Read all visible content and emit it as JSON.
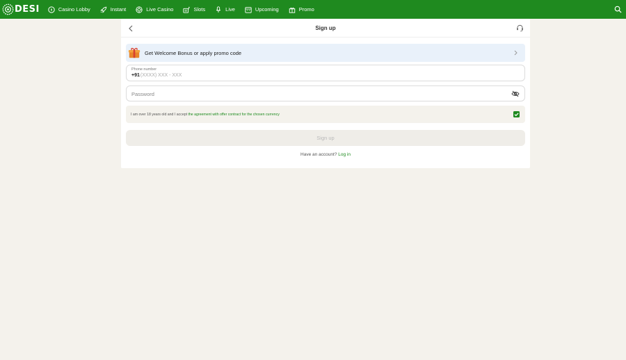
{
  "brand": {
    "logo_text": "DESI",
    "primary_color": "#1f8a1f",
    "accent_link_color": "#1e8a1e"
  },
  "nav": {
    "items": [
      {
        "label": "Casino Lobby",
        "icon": "casino-chip-icon"
      },
      {
        "label": "Instant",
        "icon": "rocket-icon"
      },
      {
        "label": "Live Casino",
        "icon": "roulette-icon"
      },
      {
        "label": "Slots",
        "icon": "slot-machine-icon"
      },
      {
        "label": "Live",
        "icon": "microphone-icon"
      },
      {
        "label": "Upcoming",
        "icon": "calendar-icon"
      },
      {
        "label": "Promo",
        "icon": "gift-icon"
      }
    ],
    "search_icon": "search-icon"
  },
  "signup": {
    "title": "Sign up",
    "promo_label": "Get Welcome Bonus or apply promo code",
    "phone": {
      "label": "Phone number",
      "code": "+91",
      "placeholder": "(XXXX) XXX - XXX"
    },
    "password": {
      "placeholder": "Password"
    },
    "agreement": {
      "text": "I am over 18 years old and I accept ",
      "link": "the agreement with offer contract for the chosen currency",
      "checked": true
    },
    "submit_label": "Sign up",
    "login_prompt": "Have an account?",
    "login_link": "Log in"
  }
}
